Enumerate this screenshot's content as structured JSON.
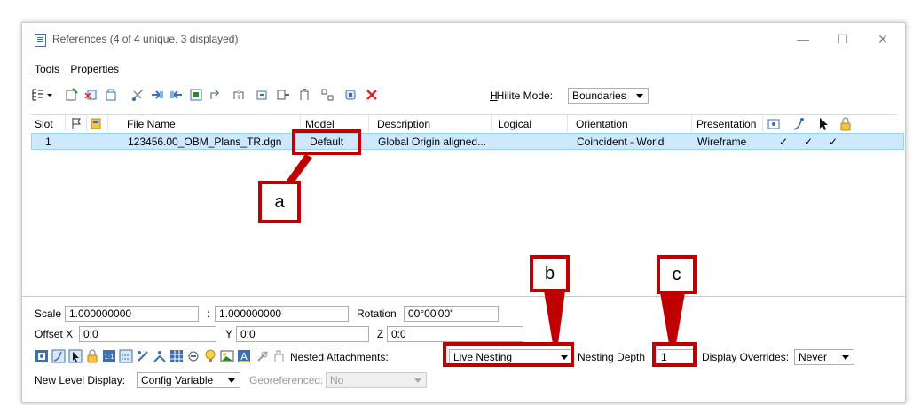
{
  "window": {
    "title": "References (4 of 4 unique, 3 displayed)",
    "minimize": "—",
    "maximize": "☐",
    "close": "✕"
  },
  "menu": [
    "Tools",
    "Properties"
  ],
  "toolbar": {
    "hilite_label": "Hilite Mode:",
    "hilite_value": "Boundaries"
  },
  "grid": {
    "columns": [
      "Slot",
      "File Name",
      "Model",
      "Description",
      "Logical",
      "Orientation",
      "Presentation"
    ],
    "rows": [
      {
        "slot": "1",
        "file_name": "123456.00_OBM_Plans_TR.dgn",
        "model": "Default",
        "description": "Global Origin aligned...",
        "logical": "",
        "orientation": "Coincident - World",
        "presentation": "Wireframe",
        "check1": "✓",
        "check2": "✓",
        "check3": "✓"
      }
    ]
  },
  "properties": {
    "scale_label": "Scale",
    "scale_value1": "1.000000000",
    "scale_sep": ":",
    "scale_value2": "1.000000000",
    "rotation_label": "Rotation",
    "rotation_value": "00°00'00\"",
    "offset_label": "Offset X",
    "offset_x": "0:0",
    "y_label": "Y",
    "offset_y": "0:0",
    "z_label": "Z",
    "offset_z": "0:0",
    "nested_label": "Nested Attachments:",
    "nested_value": "Live Nesting",
    "depth_label": "Nesting Depth",
    "depth_value": "1",
    "overrides_label": "Display Overrides:",
    "overrides_value": "Never",
    "new_level_label": "New Level Display:",
    "new_level_value": "Config Variable",
    "georef_label": "Georeferenced:",
    "georef_value": "No"
  },
  "callouts": {
    "a": "a",
    "b": "b",
    "c": "c"
  },
  "colors": {
    "callout": "#c00000",
    "selection": "#cde8ff",
    "selection_border": "#99d1ff"
  }
}
